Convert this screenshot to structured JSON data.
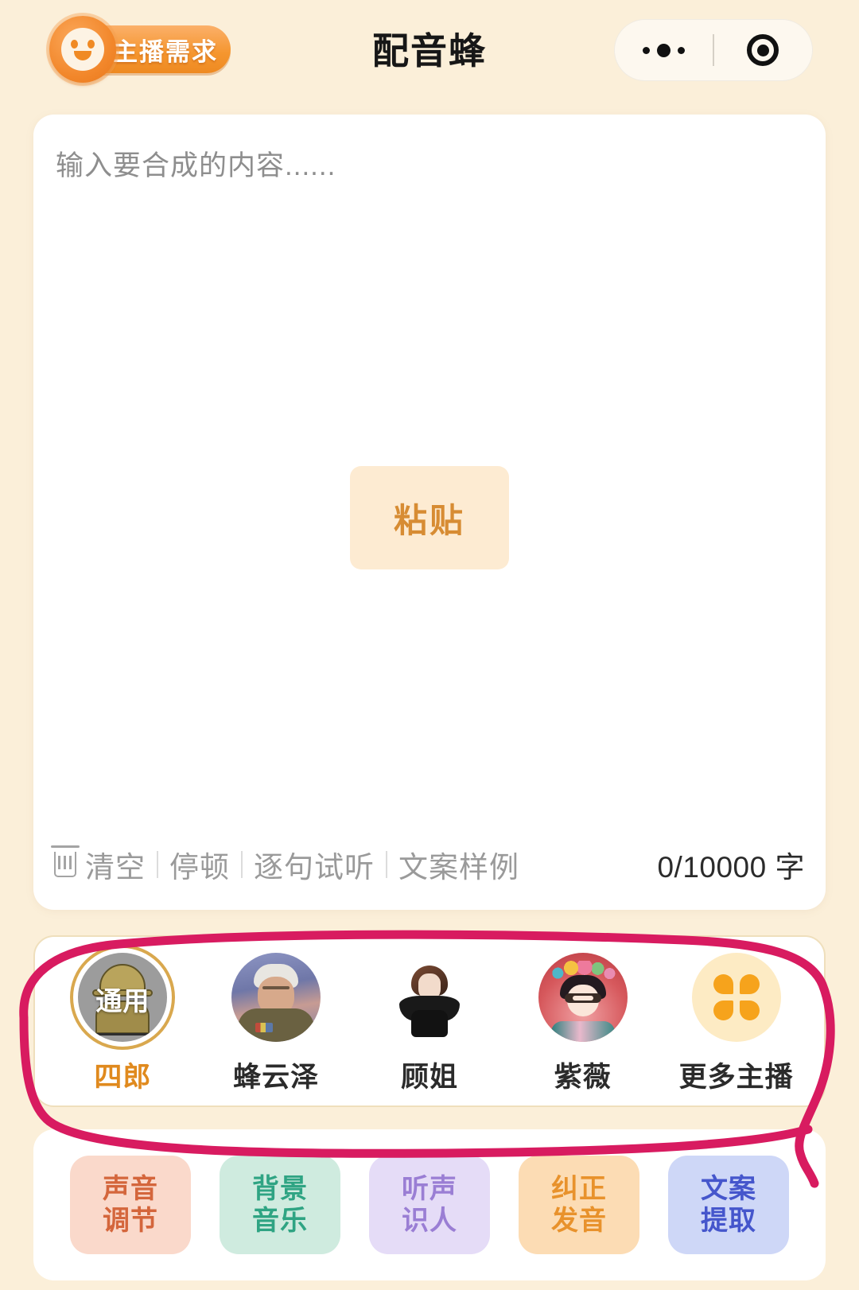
{
  "header": {
    "badge_label": "主播需求",
    "badge_icon": "smiley-face-icon",
    "title": "配音蜂",
    "capsule": {
      "menu_icon": "more-dots-icon",
      "close_icon": "target-circle-icon"
    }
  },
  "editor": {
    "placeholder": "输入要合成的内容......",
    "paste_label": "粘贴",
    "toolbar": {
      "clear_icon": "trash-icon",
      "items": [
        {
          "label": "清空"
        },
        {
          "label": "停顿"
        },
        {
          "label": "逐句试听"
        },
        {
          "label": "文案样例"
        }
      ],
      "char_count": "0/10000 字"
    }
  },
  "voices": {
    "items": [
      {
        "label": "四郎",
        "badge": "通用",
        "selected": true,
        "avatar": "generic-soldier-avatar"
      },
      {
        "label": "蜂云泽",
        "badge": "",
        "selected": false,
        "avatar": "military-officer-avatar"
      },
      {
        "label": "顾姐",
        "badge": "",
        "selected": false,
        "avatar": "woman-black-dress-avatar"
      },
      {
        "label": "紫薇",
        "badge": "",
        "selected": false,
        "avatar": "qing-princess-avatar"
      },
      {
        "label": "更多主播",
        "badge": "",
        "selected": false,
        "avatar": "clover-more-icon"
      }
    ]
  },
  "chips": {
    "items": [
      {
        "line1": "声音",
        "line2": "调节",
        "bg": "#FAD9CB",
        "fg": "#D4663C"
      },
      {
        "line1": "背景",
        "line2": "音乐",
        "bg": "#CFEBDF",
        "fg": "#2FA483"
      },
      {
        "line1": "听声",
        "line2": "识人",
        "bg": "#E5DCF7",
        "fg": "#9A7ED4"
      },
      {
        "line1": "纠正",
        "line2": "发音",
        "bg": "#FCDCB4",
        "fg": "#E8922C"
      },
      {
        "line1": "文案",
        "line2": "提取",
        "bg": "#CED7F7",
        "fg": "#4556CC"
      }
    ]
  },
  "annotation": {
    "type": "hand-drawn-circle",
    "color": "#D81B60"
  },
  "colors": {
    "page_bg": "#FBEFD9",
    "card_bg": "#FFFFFF",
    "accent_orange": "#F2872B",
    "annotation_pink": "#D81B60"
  }
}
